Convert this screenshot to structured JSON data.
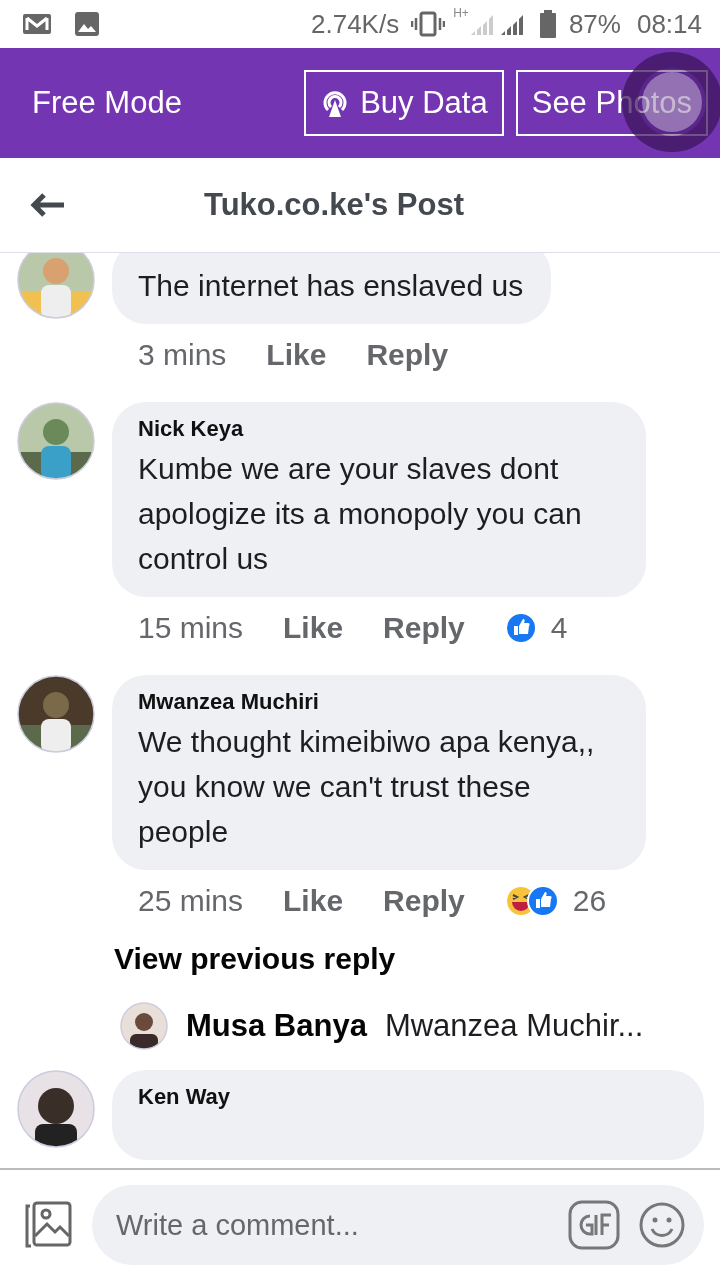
{
  "status_bar": {
    "speed": "2.74K/s",
    "network": "H+",
    "battery": "87%",
    "time": "08:14"
  },
  "mode_bar": {
    "title": "Free Mode",
    "buttons": [
      {
        "kind": "data",
        "label": "Buy Data"
      },
      {
        "kind": "photos",
        "label": "See Photos"
      }
    ]
  },
  "header": {
    "title": "Tuko.co.ke's Post"
  },
  "comments": [
    {
      "text": "The internet has enslaved us",
      "time": "3 mins",
      "like": "Like",
      "reply": "Reply"
    },
    {
      "name": "Nick Keya",
      "text": "Kumbe we are your slaves dont apologize its a monopoly you can control us",
      "time": "15 mins",
      "like": "Like",
      "reply": "Reply",
      "reactions": [
        {
          "kind": "like"
        }
      ],
      "count": "4"
    },
    {
      "name": "Mwanzea Muchiri",
      "text": "We thought kimeibiwo apa kenya,, you know we can't trust these people",
      "time": "25 mins",
      "like": "Like",
      "reply": "Reply",
      "reactions": [
        {
          "kind": "haha"
        },
        {
          "kind": "like"
        }
      ],
      "count": "26"
    }
  ],
  "replies": {
    "view_previous": "View previous reply",
    "latest": {
      "name": "Musa Banya",
      "text": "Mwanzea Muchir..."
    }
  },
  "next_comment": {
    "name": "Ken Way"
  },
  "composer": {
    "placeholder": "Write a comment..."
  }
}
